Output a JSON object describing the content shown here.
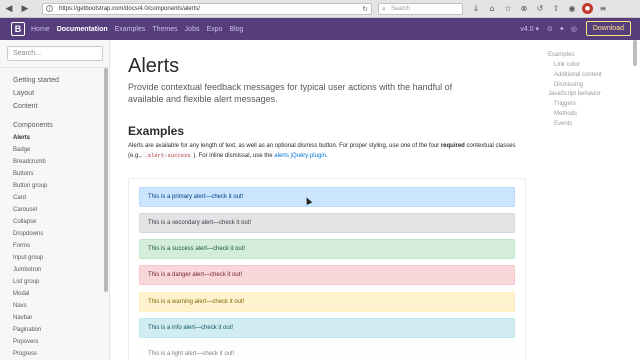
{
  "browser": {
    "url": "https://getbootstrap.com/docs/4.0/components/alerts/",
    "search_placeholder": "Search",
    "back_glyph": "◀",
    "forward_glyph": "▶",
    "reload_glyph": "↻",
    "info_glyph": "i",
    "search_glyph": "⌕",
    "toolbar_icons": [
      "download-icon",
      "home-icon",
      "bookmark-icon",
      "pocket-icon",
      "history-icon",
      "share-icon",
      "chat-icon",
      "block-icon",
      "menu-icon"
    ],
    "toolbar_glyphs": [
      "↓",
      "⌂",
      "☆",
      "⊗",
      "↺",
      "⇧",
      "◉",
      "●",
      "≡"
    ]
  },
  "navbar": {
    "brand": "B",
    "links": [
      "Home",
      "Documentation",
      "Examples",
      "Themes",
      "Jobs",
      "Expo",
      "Blog"
    ],
    "active_index": 1,
    "version": "v4.0 ▾",
    "social_glyphs": [
      "⊙",
      "✦",
      "◎"
    ],
    "download": "Download",
    "accent": "#563d7c"
  },
  "sidebar": {
    "search_placeholder": "Search...",
    "groups": [
      "Getting started",
      "Layout",
      "Content",
      "Components"
    ],
    "items": [
      "Alerts",
      "Badge",
      "Breadcrumb",
      "Buttons",
      "Button group",
      "Card",
      "Carousel",
      "Collapse",
      "Dropdowns",
      "Forms",
      "Input group",
      "Jumbotron",
      "List group",
      "Modal",
      "Navs",
      "Navbar",
      "Pagination",
      "Popovers",
      "Progress"
    ],
    "current_index": 0
  },
  "main": {
    "title": "Alerts",
    "lead": "Provide contextual feedback messages for typical user actions with the handful of available and flexible alert messages.",
    "examples_heading": "Examples",
    "para_1": "Alerts are available for any length of text, as well as an optional dismiss button. For proper styling, use one of the four",
    "para_required": "required",
    "para_2": "contextual classes (e.g.,",
    "para_code": ".alert-success",
    "para_3": "). For inline dismissal, use the",
    "para_link": "alerts jQuery plugin",
    "para_end": "."
  },
  "alerts": [
    {
      "text": "This is a primary alert—check it out!",
      "bg": "#cce5ff",
      "border": "#b8daff",
      "color": "#004085"
    },
    {
      "text": "This is a secondary alert—check it out!",
      "bg": "#e2e3e5",
      "border": "#d6d8db",
      "color": "#383d41"
    },
    {
      "text": "This is a success alert—check it out!",
      "bg": "#d4edda",
      "border": "#c3e6cb",
      "color": "#155724"
    },
    {
      "text": "This is a danger alert—check it out!",
      "bg": "#f8d7da",
      "border": "#f5c6cb",
      "color": "#721c24"
    },
    {
      "text": "This is a warning alert—check it out!",
      "bg": "#fff3cd",
      "border": "#ffeeba",
      "color": "#856404"
    },
    {
      "text": "This is a info alert—check it out!",
      "bg": "#d1ecf1",
      "border": "#bee5eb",
      "color": "#0c5460"
    },
    {
      "text": "This is a light alert—check it out!",
      "bg": "#fefefe",
      "border": "#fdfdfe",
      "color": "#818182"
    }
  ],
  "toc": {
    "items": [
      "Examples",
      "Link color",
      "Additional content",
      "Dismissing",
      "JavaScript behavior",
      "Triggers",
      "Methods",
      "Events"
    ]
  }
}
